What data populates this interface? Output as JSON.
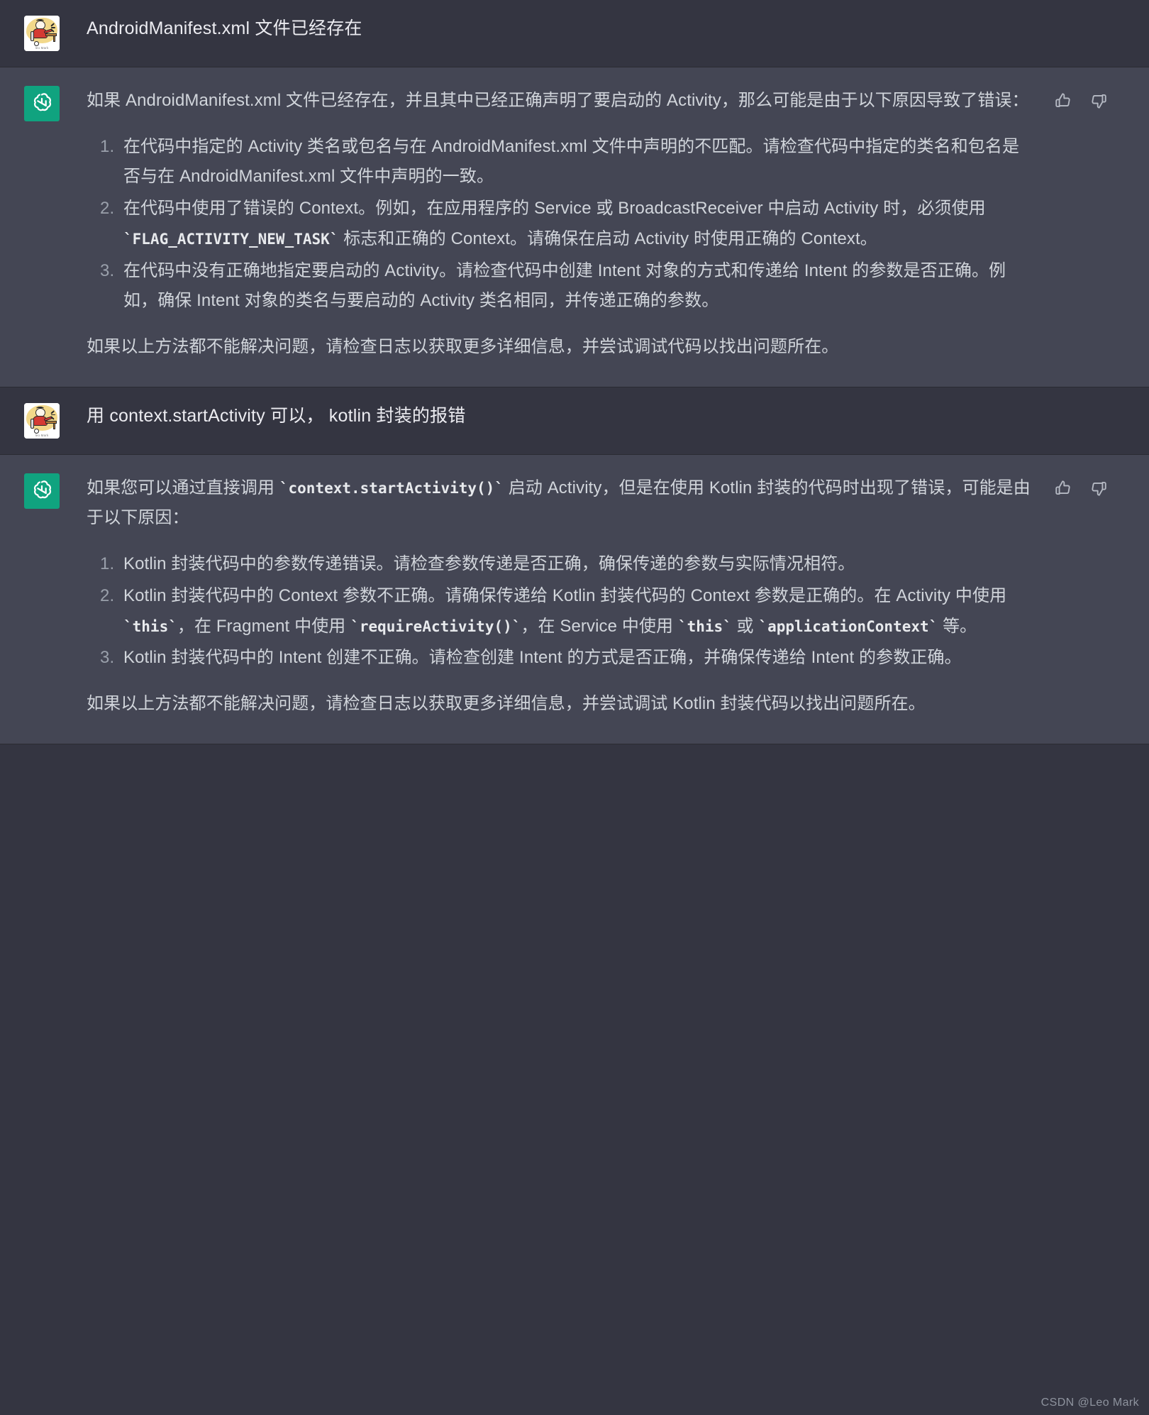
{
  "theme": {
    "user_row_bg": "#343541",
    "assistant_row_bg": "#444654",
    "accent_green": "#10a37f",
    "text_color": "#d1d5db"
  },
  "avatars": {
    "user_caption": "leo Mark",
    "assistant_icon": "openai-logo-icon"
  },
  "messages": [
    {
      "role": "user",
      "name": "user-message-1",
      "text": "AndroidManifest.xml 文件已经存在"
    },
    {
      "role": "assistant",
      "name": "assistant-message-1",
      "intro": "如果 AndroidManifest.xml 文件已经存在，并且其中已经正确声明了要启动的 Activity，那么可能是由于以下原因导致了错误：",
      "list": [
        {
          "parts": [
            {
              "t": "text",
              "v": "在代码中指定的 Activity 类名或包名与在 AndroidManifest.xml 文件中声明的不匹配。请检查代码中指定的类名和包名是否与在 AndroidManifest.xml 文件中声明的一致。"
            }
          ]
        },
        {
          "parts": [
            {
              "t": "text",
              "v": "在代码中使用了错误的 Context。例如，在应用程序的 Service 或 BroadcastReceiver 中启动 Activity 时，必须使用 "
            },
            {
              "t": "code",
              "v": "`FLAG_ACTIVITY_NEW_TASK`"
            },
            {
              "t": "text",
              "v": " 标志和正确的 Context。请确保在启动 Activity 时使用正确的 Context。"
            }
          ]
        },
        {
          "parts": [
            {
              "t": "text",
              "v": "在代码中没有正确地指定要启动的 Activity。请检查代码中创建 Intent 对象的方式和传递给 Intent 的参数是否正确。例如，确保 Intent 对象的类名与要启动的 Activity 类名相同，并传递正确的参数。"
            }
          ]
        }
      ],
      "outro": "如果以上方法都不能解决问题，请检查日志以获取更多详细信息，并尝试调试代码以找出问题所在。"
    },
    {
      "role": "user",
      "name": "user-message-2",
      "text": "用 context.startActivity 可以， kotlin 封装的报错"
    },
    {
      "role": "assistant",
      "name": "assistant-message-2",
      "intro_parts": [
        {
          "t": "text",
          "v": "如果您可以通过直接调用 "
        },
        {
          "t": "code",
          "v": "`context.startActivity()`"
        },
        {
          "t": "text",
          "v": " 启动 Activity，但是在使用 Kotlin 封装的代码时出现了错误，可能是由于以下原因："
        }
      ],
      "list": [
        {
          "parts": [
            {
              "t": "text",
              "v": "Kotlin 封装代码中的参数传递错误。请检查参数传递是否正确，确保传递的参数与实际情况相符。"
            }
          ]
        },
        {
          "parts": [
            {
              "t": "text",
              "v": "Kotlin 封装代码中的 Context 参数不正确。请确保传递给 Kotlin 封装代码的 Context 参数是正确的。在 Activity 中使用 "
            },
            {
              "t": "code",
              "v": "`this`"
            },
            {
              "t": "text",
              "v": "，在 Fragment 中使用 "
            },
            {
              "t": "code",
              "v": "`requireActivity()`"
            },
            {
              "t": "text",
              "v": "，在 Service 中使用 "
            },
            {
              "t": "code",
              "v": "`this`"
            },
            {
              "t": "text",
              "v": " 或 "
            },
            {
              "t": "code",
              "v": "`applicationContext`"
            },
            {
              "t": "text",
              "v": " 等。"
            }
          ]
        },
        {
          "parts": [
            {
              "t": "text",
              "v": "Kotlin 封装代码中的 Intent 创建不正确。请检查创建 Intent 的方式是否正确，并确保传递给 Intent 的参数正确。"
            }
          ]
        }
      ],
      "outro": "如果以上方法都不能解决问题，请检查日志以获取更多详细信息，并尝试调试 Kotlin 封装代码以找出问题所在。"
    }
  ],
  "feedback": {
    "thumbs_up": "thumbs-up-icon",
    "thumbs_down": "thumbs-down-icon"
  },
  "watermark": "CSDN @Leo Mark"
}
